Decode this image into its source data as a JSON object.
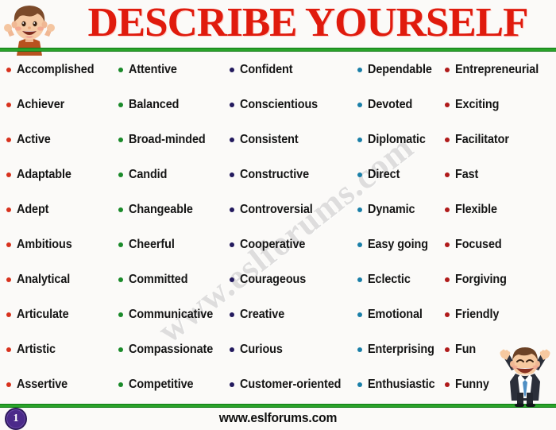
{
  "page": {
    "title": "DESCRIBE YOURSELF",
    "background_color": "#faf9f7",
    "rule_color": "#2aa32a",
    "watermark_text": "www.eslforums.com"
  },
  "header": {
    "title": "DESCRIBE YOURSELF",
    "title_color": "#e01b0d",
    "mascot_icon": "happy-boy-icon"
  },
  "footer": {
    "page_number": "1",
    "page_badge_color": "#4b2a8a",
    "url": "www.eslforums.com",
    "mascot_icon": "cheering-businessman-icon"
  },
  "columns": [
    {
      "index": 1,
      "bullet_color": "#d8321e",
      "words": [
        "Accomplished",
        "Achiever",
        "Active",
        "Adaptable",
        "Adept",
        "Ambitious",
        "Analytical",
        "Articulate",
        "Artistic",
        "Assertive"
      ]
    },
    {
      "index": 2,
      "bullet_color": "#1a8a2a",
      "words": [
        "Attentive",
        "Balanced",
        "Broad-minded",
        "Candid",
        "Changeable",
        "Cheerful",
        "Committed",
        "Communicative",
        "Compassionate",
        "Competitive"
      ]
    },
    {
      "index": 3,
      "bullet_color": "#231a5e",
      "words": [
        "Confident",
        "Conscientious",
        "Consistent",
        "Constructive",
        "Controversial",
        "Cooperative",
        "Courageous",
        "Creative",
        "Curious",
        "Customer-oriented"
      ]
    },
    {
      "index": 4,
      "bullet_color": "#1a7fa8",
      "words": [
        "Dependable",
        "Devoted",
        "Diplomatic",
        "Direct",
        "Dynamic",
        "Easy going",
        "Eclectic",
        "Emotional",
        "Enterprising",
        "Enthusiastic"
      ]
    },
    {
      "index": 5,
      "bullet_color": "#b01a1a",
      "words": [
        "Entrepreneurial",
        "Exciting",
        "Facilitator",
        "Fast",
        "Flexible",
        "Focused",
        "Forgiving",
        "Friendly",
        "Fun",
        "Funny"
      ]
    }
  ]
}
